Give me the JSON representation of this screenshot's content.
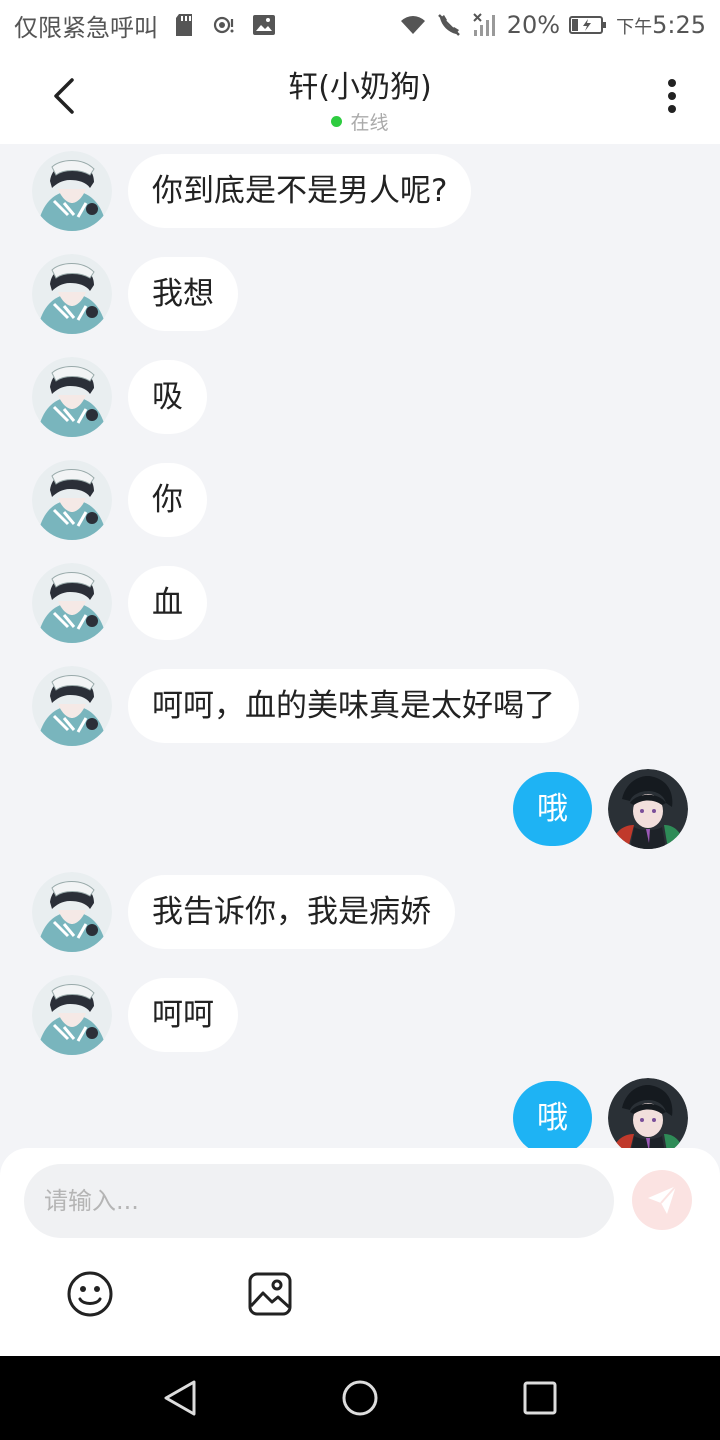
{
  "status_bar": {
    "carrier": "仅限紧急呼叫",
    "battery": "20%",
    "time_prefix": "下午",
    "time": "5:25",
    "icons": [
      "sd-card-icon",
      "hotspot-icon",
      "image-icon",
      "wifi-icon",
      "call-off-icon",
      "no-signal-icon",
      "battery-charging-icon"
    ]
  },
  "header": {
    "title": "轩(小奶狗)",
    "status": "在线",
    "status_color": "#2ecc40"
  },
  "messages": [
    {
      "side": "recv",
      "text": "你到底是不是男人呢?"
    },
    {
      "side": "recv",
      "text": "我想"
    },
    {
      "side": "recv",
      "text": "吸"
    },
    {
      "side": "recv",
      "text": "你"
    },
    {
      "side": "recv",
      "text": "血"
    },
    {
      "side": "recv",
      "text": "呵呵，血的美味真是太好喝了"
    },
    {
      "side": "sent",
      "text": "哦"
    },
    {
      "side": "recv",
      "text": "我告诉你，我是病娇"
    },
    {
      "side": "recv",
      "text": "呵呵"
    },
    {
      "side": "sent",
      "text": "哦"
    }
  ],
  "composer": {
    "placeholder": "请输入...",
    "value": ""
  },
  "colors": {
    "sent_bubble": "#1eb3f4",
    "recv_bubble": "#ffffff",
    "background": "#f3f4f7"
  }
}
